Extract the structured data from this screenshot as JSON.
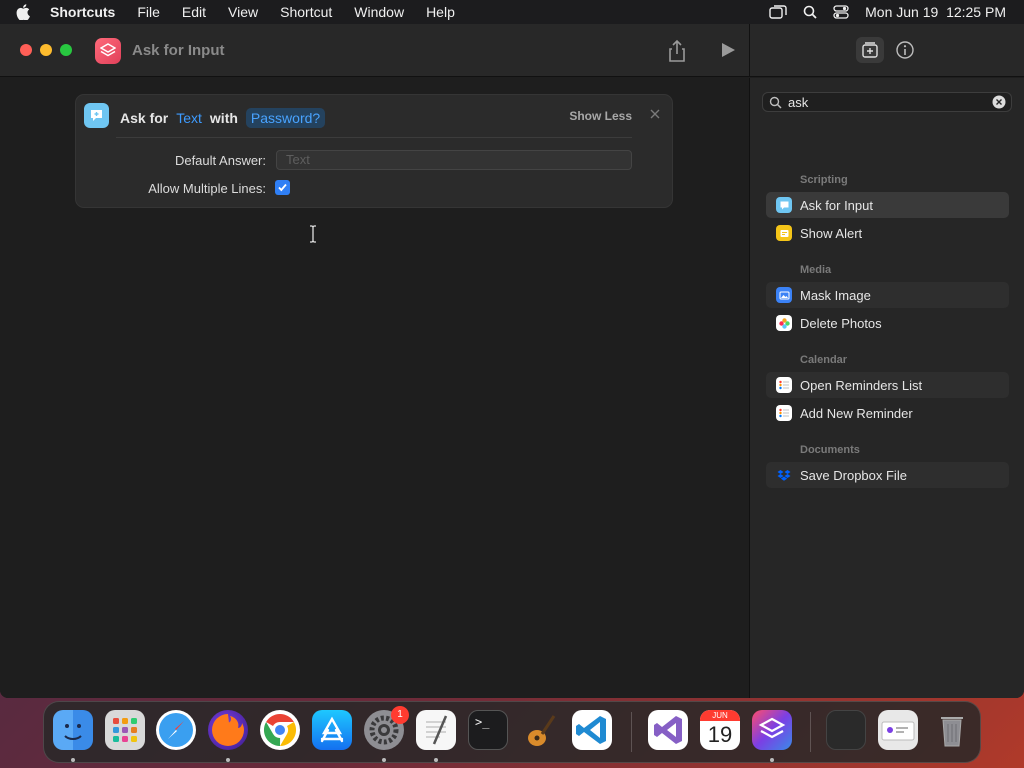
{
  "menubar": {
    "app": "Shortcuts",
    "items": [
      "File",
      "Edit",
      "View",
      "Shortcut",
      "Window",
      "Help"
    ],
    "clock": "Mon Jun 19  12:25 PM"
  },
  "window": {
    "title": "Ask for Input"
  },
  "action": {
    "prefix": "Ask for",
    "type_token": "Text",
    "with": "with",
    "password_token": "Password?",
    "show_less": "Show Less",
    "default_answer_label": "Default Answer:",
    "default_answer_placeholder": "Text",
    "multi_lines_label": "Allow Multiple Lines:",
    "multi_lines_checked": true
  },
  "sidebar": {
    "search_value": "ask",
    "sections": [
      {
        "header": "Scripting",
        "items": [
          {
            "label": "Ask for Input",
            "icon": "ask-input-icon",
            "color": "#6fc6f2"
          },
          {
            "label": "Show Alert",
            "icon": "alert-icon",
            "color": "#f5c518"
          }
        ]
      },
      {
        "header": "Media",
        "items": [
          {
            "label": "Mask Image",
            "icon": "image-icon",
            "color": "#3b82f6"
          },
          {
            "label": "Delete Photos",
            "icon": "photos-icon",
            "color": "#ffffff"
          }
        ]
      },
      {
        "header": "Calendar",
        "items": [
          {
            "label": "Open Reminders List",
            "icon": "reminders-icon",
            "color": "#ffffff"
          },
          {
            "label": "Add New Reminder",
            "icon": "reminders-icon",
            "color": "#ffffff"
          }
        ]
      },
      {
        "header": "Documents",
        "items": [
          {
            "label": "Save Dropbox File",
            "icon": "dropbox-icon",
            "color": "#0061ff"
          }
        ]
      }
    ]
  },
  "dock": {
    "settings_badge": "1",
    "calendar_month": "JUN",
    "calendar_day": "19",
    "terminal_prompt": ">_"
  }
}
